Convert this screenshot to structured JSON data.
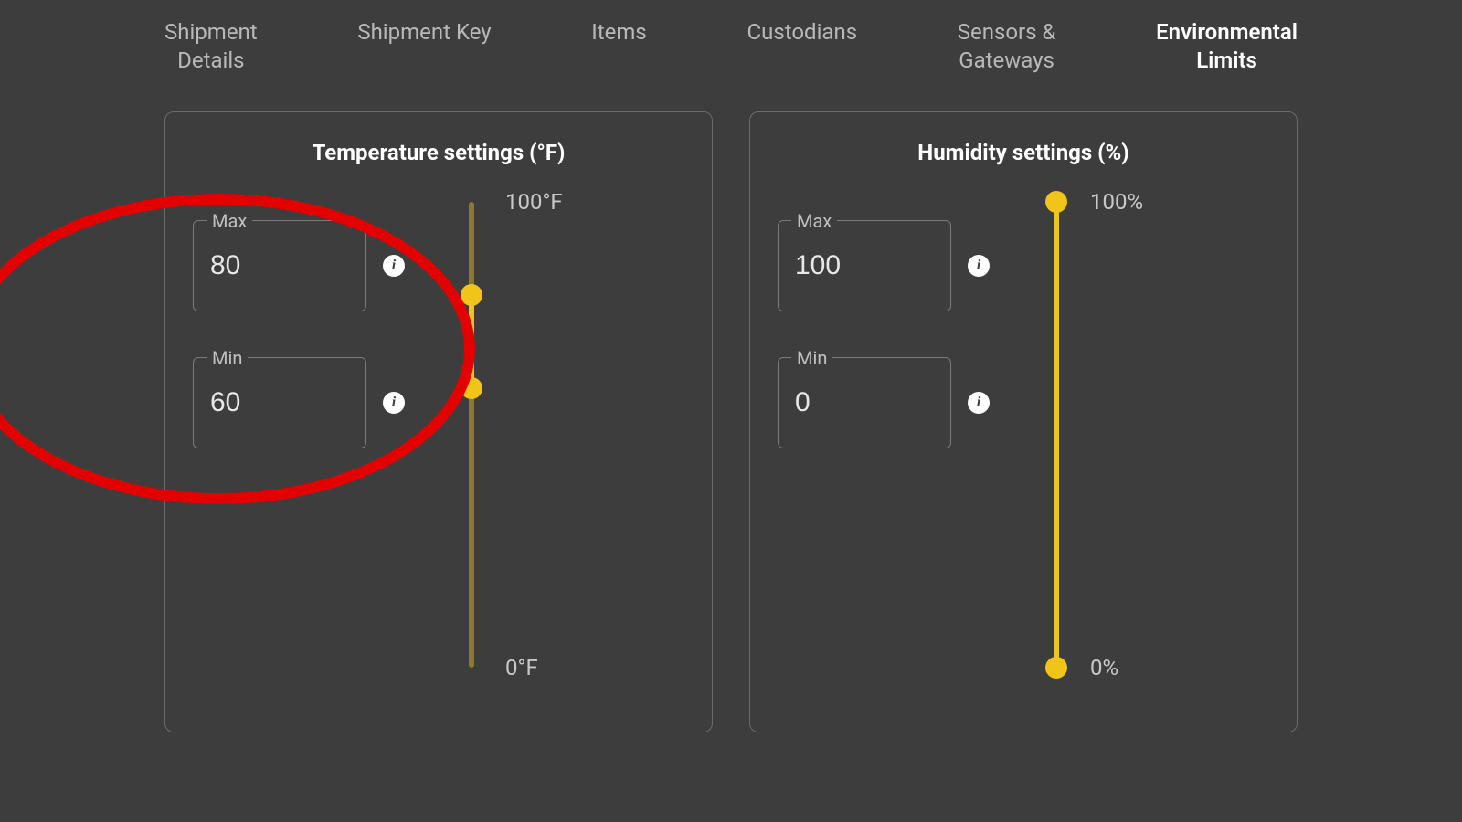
{
  "tabs": [
    {
      "label": "Shipment\nDetails",
      "active": false
    },
    {
      "label": "Shipment Key",
      "active": false
    },
    {
      "label": "Items",
      "active": false
    },
    {
      "label": "Custodians",
      "active": false
    },
    {
      "label": "Sensors &\nGateways",
      "active": false
    },
    {
      "label": "Environmental\nLimits",
      "active": true
    }
  ],
  "temperature": {
    "title": "Temperature settings (°F)",
    "max_label": "Max",
    "max_value": "80",
    "min_label": "Min",
    "min_value": "60",
    "scale_top": "100°F",
    "scale_bottom": "0°F",
    "range_min": 0,
    "range_max": 100
  },
  "humidity": {
    "title": "Humidity settings (%)",
    "max_label": "Max",
    "max_value": "100",
    "min_label": "Min",
    "min_value": "0",
    "scale_top": "100%",
    "scale_bottom": "0%",
    "range_min": 0,
    "range_max": 100
  },
  "colors": {
    "accent": "#f0c419",
    "annotation": "#e20000"
  }
}
